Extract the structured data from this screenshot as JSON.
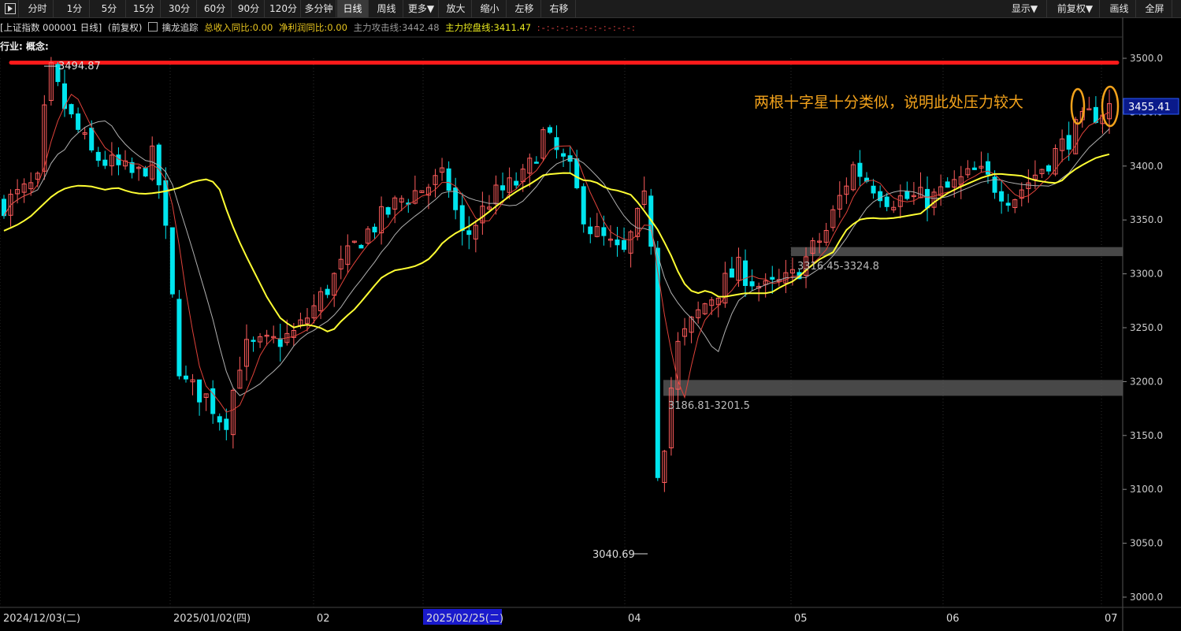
{
  "toolbar": {
    "buttons": [
      {
        "label": "分时",
        "x": 28,
        "w": 40
      },
      {
        "label": "1分",
        "x": 76,
        "w": 38
      },
      {
        "label": "5分",
        "x": 118,
        "w": 42
      },
      {
        "label": "15分",
        "x": 162,
        "w": 42
      },
      {
        "label": "30分",
        "x": 206,
        "w": 44
      },
      {
        "label": "60分",
        "x": 252,
        "w": 42
      },
      {
        "label": "90分",
        "x": 296,
        "w": 40
      },
      {
        "label": "120分",
        "x": 338,
        "w": 44
      },
      {
        "label": "多分钟",
        "x": 383,
        "w": 44
      },
      {
        "label": "日线",
        "x": 428,
        "w": 40,
        "active": true
      },
      {
        "label": "周线",
        "x": 470,
        "w": 42
      },
      {
        "label": "更多▼",
        "x": 513,
        "w": 44
      },
      {
        "label": "放大",
        "x": 559,
        "w": 40
      },
      {
        "label": "缩小",
        "x": 601,
        "w": 42
      },
      {
        "label": "左移",
        "x": 645,
        "w": 42
      },
      {
        "label": "右移",
        "x": 689,
        "w": 42
      },
      {
        "label": "显示▼",
        "x": 1273,
        "w": 56
      },
      {
        "label": "前复权▼",
        "x": 1334,
        "w": 62
      },
      {
        "label": "画线",
        "x": 1400,
        "w": 42
      },
      {
        "label": "全屏",
        "x": 1444,
        "w": 44
      }
    ]
  },
  "info": {
    "index": "[上证指数 000001 日线]",
    "adjust": "(前复权)",
    "indicator": "擒龙追踪",
    "revenue": "总收入同比:0.00",
    "profit": "净利润同比:0.00",
    "attack": "主力攻击线:3442.48",
    "control": "主力控盘线:3411.47",
    "dots": ":-:-:-:-:-:-:-:-:-:-:"
  },
  "industry_label": "行业: 概念:",
  "annotation": "两根十字星十分类似，说明此处压力较大",
  "labels": {
    "high": "3494.87",
    "low": "3040.69",
    "zone1": "3316.45-3324.8",
    "zone2": "3186.81-3201.5",
    "last_price": "3455.41"
  },
  "colors": {
    "up": "#ff5c5c",
    "down": "#00e5ee",
    "ma_short": "#e0423a",
    "ma_mid": "#b0b0b0",
    "ma_long": "#ffff33",
    "red_line": "#ff1a1a",
    "zone": "#555555",
    "annotation": "#f2a21b"
  },
  "chart_data": {
    "type": "candlestick",
    "y_ticks": [
      "3500.0",
      "3450.0",
      "3400.0",
      "3350.0",
      "3300.0",
      "3250.0",
      "3200.0",
      "3150.0",
      "3100.0",
      "3050.0",
      "3000.0"
    ],
    "ylim": [
      3000,
      3500
    ],
    "x_ticks": [
      "2024/12/03(二)",
      "2025/01/02(四)",
      "02",
      "2025/02/25(二)",
      "04",
      "05",
      "06",
      "07"
    ],
    "resistance_level": 3496,
    "zones": [
      [
        3316.45,
        3324.8
      ],
      [
        3186.81,
        3201.5
      ]
    ],
    "ma_long": [
      3340,
      3345,
      3352,
      3363,
      3374,
      3380,
      3382,
      3381,
      3378,
      3380,
      3376,
      3374,
      3375,
      3377,
      3380,
      3385,
      3388,
      3384,
      3350,
      3323,
      3300,
      3277,
      3259,
      3250,
      3253,
      3251,
      3245,
      3258,
      3268,
      3282,
      3296,
      3303,
      3305,
      3308,
      3315,
      3330,
      3338,
      3344,
      3352,
      3361,
      3370,
      3378,
      3384,
      3392,
      3393,
      3394,
      3387,
      3386,
      3379,
      3377,
      3373,
      3358,
      3342,
      3320,
      3293,
      3281,
      3285,
      3278,
      3280,
      3282,
      3282,
      3282,
      3289,
      3294,
      3305,
      3314,
      3320,
      3340,
      3350,
      3352,
      3351,
      3352,
      3354,
      3356,
      3366,
      3374,
      3380,
      3385,
      3390,
      3393,
      3392,
      3391,
      3387,
      3385,
      3384,
      3395,
      3402,
      3408,
      3411
    ]
  }
}
